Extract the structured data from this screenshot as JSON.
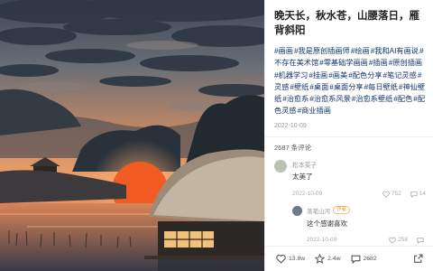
{
  "post": {
    "title": "晚天长，秋水苍，山腰落日，雁背斜阳",
    "tags": [
      "#画画",
      "#我是原创插画师",
      "#绘画",
      "#我和AI有画说",
      "#不存在美术馆",
      "#零基础学画画",
      "#插画",
      "#原创插画",
      "#机器学习",
      "#挂画",
      "#画美",
      "#配色分享",
      "#笔记灵感",
      "#灵感",
      "#壁纸",
      "#桌面",
      "#桌面分享",
      "#每日壁纸",
      "#神仙壁纸",
      "#治愈系",
      "#治愈系风景",
      "#治愈系壁纸",
      "#配色",
      "#配色灵感",
      "#商业插画"
    ],
    "date": "2022-10-09"
  },
  "comments": {
    "count_label": "2687 条评论",
    "first": {
      "user": "松本菜子",
      "text": "太美了",
      "date": "2022-10-09",
      "likes": "752",
      "replies": "14",
      "avatar_color": "#b8c4b0"
    },
    "reply": {
      "user": "落笔山河",
      "badge": "作者",
      "text": "这个感谢喜欢",
      "date": "2022-10-09",
      "likes": "258",
      "avatar_color": "#6a7b8c"
    }
  },
  "footer": {
    "likes": "13.8w",
    "collects": "2.4w",
    "comments": "2682"
  },
  "colors": {
    "tag": "#13386c",
    "sun": "#f25c22",
    "sky_top": "#4a5566",
    "sky_glow": "#f2a36b"
  }
}
